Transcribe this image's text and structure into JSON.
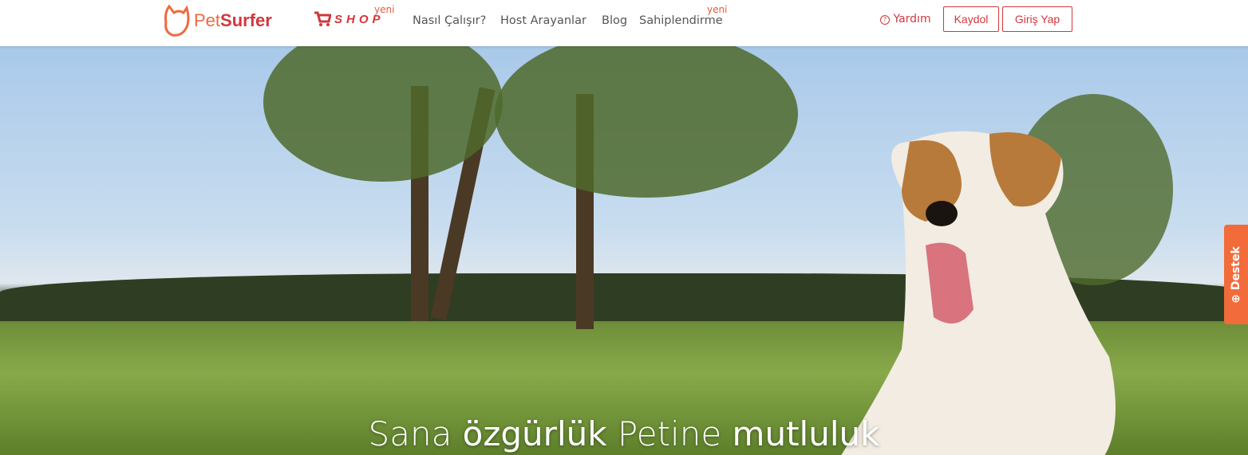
{
  "nav": {
    "brand": {
      "part1": "Pet",
      "part2": "Surfer"
    },
    "shop_label": "SHOP",
    "shop_badge": "yeni",
    "links": [
      {
        "label": "Nasıl Çalışır?"
      },
      {
        "label": "Host Arayanlar"
      },
      {
        "label": "Blog"
      },
      {
        "label": "Sahiplendirme",
        "badge": "yeni"
      }
    ],
    "help_label": "Yardım",
    "signup_label": "Kaydol",
    "login_label": "Giriş Yap"
  },
  "hero": {
    "headline_1": "Sana ",
    "headline_2": "özgürlük",
    "headline_3": " Petine ",
    "headline_4": "mutluluk"
  },
  "support_tab": "Destek",
  "colors": {
    "brand": "#d2373c",
    "accent": "#f26b3a"
  }
}
